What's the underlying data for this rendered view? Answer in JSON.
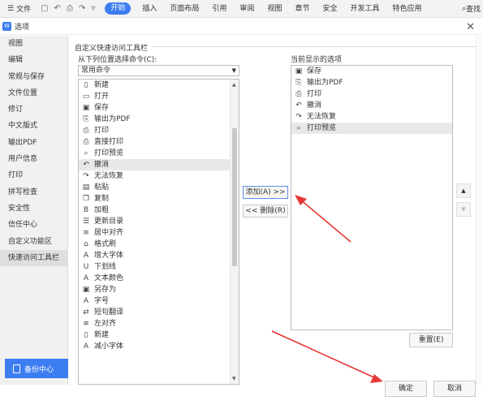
{
  "ribbon": {
    "file_label": "文件",
    "qa_icons": [
      "save-icon",
      "undo-icon",
      "print-icon",
      "redo-icon",
      "customize-icon"
    ],
    "tabs": [
      {
        "label": "开始",
        "active": true
      },
      {
        "label": "插入",
        "active": false
      },
      {
        "label": "页面布局",
        "active": false
      },
      {
        "label": "引用",
        "active": false
      },
      {
        "label": "审阅",
        "active": false
      },
      {
        "label": "视图",
        "active": false
      },
      {
        "label": "章节",
        "active": false
      },
      {
        "label": "安全",
        "active": false
      },
      {
        "label": "开发工具",
        "active": false
      },
      {
        "label": "特色应用",
        "active": false
      }
    ],
    "search_label": "查找"
  },
  "dialog": {
    "title": "选项",
    "close_glyph": "✕"
  },
  "sidebar": {
    "items": [
      {
        "label": "视图",
        "active": false
      },
      {
        "label": "编辑",
        "active": false
      },
      {
        "label": "常规与保存",
        "active": false
      },
      {
        "label": "文件位置",
        "active": false
      },
      {
        "label": "修订",
        "active": false
      },
      {
        "label": "中文版式",
        "active": false
      },
      {
        "label": "输出PDF",
        "active": false
      },
      {
        "label": "用户信息",
        "active": false
      },
      {
        "label": "打印",
        "active": false
      },
      {
        "label": "拼写检查",
        "active": false
      },
      {
        "label": "安全性",
        "active": false
      },
      {
        "label": "信任中心",
        "active": false
      },
      {
        "label": "自定义功能区",
        "active": false
      },
      {
        "label": "快速访问工具栏",
        "active": true
      }
    ],
    "backup_label": "备份中心"
  },
  "panel": {
    "section_title": "自定义快速访问工具栏",
    "choose_label": "从下列位置选择命令(C):",
    "combo_value": "常用命令",
    "commands": [
      {
        "label": "新建",
        "icon": "new-doc-icon",
        "selected": false
      },
      {
        "label": "打开",
        "icon": "open-icon",
        "selected": false
      },
      {
        "label": "保存",
        "icon": "save-icon",
        "selected": false
      },
      {
        "label": "输出为PDF",
        "icon": "pdf-icon",
        "selected": false
      },
      {
        "label": "打印",
        "icon": "print-icon",
        "selected": false
      },
      {
        "label": "直接打印",
        "icon": "direct-print-icon",
        "selected": false
      },
      {
        "label": "打印预览",
        "icon": "print-preview-icon",
        "selected": false
      },
      {
        "label": "撤消",
        "icon": "undo-icon",
        "selected": true
      },
      {
        "label": "无法恢复",
        "icon": "redo-icon",
        "selected": false
      },
      {
        "label": "粘贴",
        "icon": "paste-icon",
        "selected": false
      },
      {
        "label": "复制",
        "icon": "copy-icon",
        "selected": false
      },
      {
        "label": "加粗",
        "icon": "bold-icon",
        "selected": false
      },
      {
        "label": "更新目录",
        "icon": "update-toc-icon",
        "selected": false
      },
      {
        "label": "居中对齐",
        "icon": "align-center-icon",
        "selected": false
      },
      {
        "label": "格式刷",
        "icon": "format-painter-icon",
        "selected": false
      },
      {
        "label": "增大字体",
        "icon": "grow-font-icon",
        "selected": false
      },
      {
        "label": "下划线",
        "icon": "underline-icon",
        "selected": false
      },
      {
        "label": "文本颜色",
        "icon": "font-color-icon",
        "selected": false
      },
      {
        "label": "另存为",
        "icon": "save-as-icon",
        "selected": false
      },
      {
        "label": "字号",
        "icon": "font-size-icon",
        "selected": false
      },
      {
        "label": "短句翻译",
        "icon": "translate-icon",
        "selected": false
      },
      {
        "label": "左对齐",
        "icon": "align-left-icon",
        "selected": false
      },
      {
        "label": "新建",
        "icon": "new-doc-icon",
        "selected": false
      },
      {
        "label": "减小字体",
        "icon": "shrink-font-icon",
        "selected": false
      }
    ],
    "add_button": "添加(A) >>",
    "remove_button": "<< 删除(R)",
    "current_label": "当前显示的选项",
    "current_items": [
      {
        "label": "保存",
        "icon": "save-icon",
        "selected": false
      },
      {
        "label": "输出为PDF",
        "icon": "pdf-icon",
        "selected": false
      },
      {
        "label": "打印",
        "icon": "print-icon",
        "selected": false
      },
      {
        "label": "撤消",
        "icon": "undo-icon",
        "selected": false
      },
      {
        "label": "无法恢复",
        "icon": "redo-icon",
        "selected": false
      },
      {
        "label": "打印预览",
        "icon": "print-preview-icon",
        "selected": true
      }
    ],
    "move_up_glyph": "▲",
    "move_down_glyph": "▼",
    "reset_button": "重置(E)"
  },
  "footer": {
    "ok_button": "确定",
    "cancel_button": "取消"
  },
  "colors": {
    "accent": "#3c7df1",
    "arrow_red": "#e53935"
  }
}
